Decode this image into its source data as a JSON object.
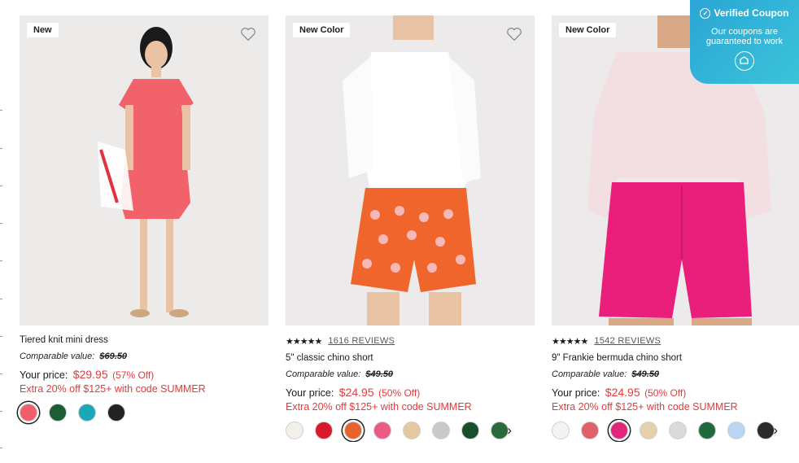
{
  "coupon": {
    "title": "Verified Coupon",
    "subtitle": "Our coupons are guaranteed to work"
  },
  "products": [
    {
      "badge": "New",
      "rating_stars": "",
      "reviews": "",
      "title": "Tiered knit mini dress",
      "comparable_label": "Comparable value:",
      "comparable_price": "$69.50",
      "price_label": "Your price:",
      "sale_price": "$29.95",
      "discount": "(57% Off)",
      "promo": "Extra 20% off $125+ with code SUMMER",
      "swatches": [
        "#f0606a",
        "#1d5d34",
        "#1aa8b8",
        "#222222"
      ],
      "selected": 0
    },
    {
      "badge": "New Color",
      "rating_stars": "★★★★★",
      "reviews": "1616 REVIEWS",
      "title": "5\" classic chino short",
      "comparable_label": "Comparable value:",
      "comparable_price": "$49.50",
      "price_label": "Your price:",
      "sale_price": "$24.95",
      "discount": "(50% Off)",
      "promo": "Extra 20% off $125+ with code SUMMER",
      "swatches": [
        "#f2f0e9",
        "#d7192a",
        "#e8622c",
        "#ec5b84",
        "#e3c8a0",
        "#c9c9c9",
        "#174f2b",
        "#2a6a3a"
      ],
      "selected": 2
    },
    {
      "badge": "New Color",
      "rating_stars": "★★★★★",
      "reviews": "1542 REVIEWS",
      "title": "9\" Frankie bermuda chino short",
      "comparable_label": "Comparable value:",
      "comparable_price": "$49.50",
      "price_label": "Your price:",
      "sale_price": "$24.95",
      "discount": "(50% Off)",
      "promo": "Extra 20% off $125+ with code SUMMER",
      "swatches": [
        "#f4f3f0",
        "#e0606a",
        "#e0267a",
        "#e5cfae",
        "#dadada",
        "#1f6a3c",
        "#b8d6f3",
        "#2a2a2a"
      ],
      "selected": 2
    }
  ],
  "icons": {
    "heart": "heart-icon",
    "next": "chevron-right-icon",
    "check": "check-circle-icon",
    "coupon_logo": "coupon-logo-icon"
  }
}
